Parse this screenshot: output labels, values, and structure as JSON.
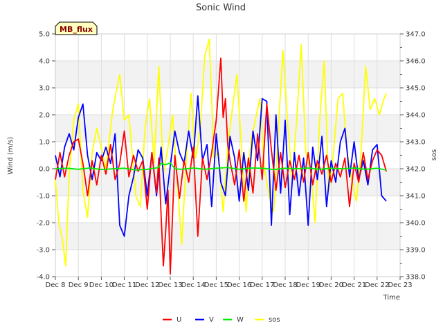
{
  "chart_data": {
    "type": "line",
    "title": "Sonic Wind",
    "badge": "MB_flux",
    "xlabel": "Time",
    "ylabel": "Wind (m/s)",
    "y2label": "sos",
    "x_ticks": [
      "Dec 8",
      "Dec 9",
      "Dec 10",
      "Dec 11",
      "Dec 12",
      "Dec 13",
      "Dec 14",
      "Dec 15",
      "Dec 16",
      "Dec 17",
      "Dec 18",
      "Dec 19",
      "Dec 20",
      "Dec 21",
      "Dec 22",
      "Dec 23"
    ],
    "xlim": [
      0,
      15
    ],
    "ylim": [
      -4.0,
      5.0
    ],
    "y_ticks": [
      "-4.0",
      "-3.0",
      "-2.0",
      "-1.0",
      "0.0",
      "1.0",
      "2.0",
      "3.0",
      "4.0",
      "5.0"
    ],
    "y2lim": [
      338.0,
      347.0
    ],
    "y2_ticks": [
      "338.0",
      "339.0",
      "340.0",
      "341.0",
      "342.0",
      "343.0",
      "344.0",
      "345.0",
      "346.0",
      "347.0"
    ],
    "grid": true,
    "legend_position": "bottom",
    "series": [
      {
        "name": "U",
        "color": "#ff0000",
        "axis": "left",
        "x": [
          0.0,
          0.2,
          0.4,
          0.6,
          0.8,
          1.0,
          1.2,
          1.4,
          1.6,
          1.8,
          2.0,
          2.2,
          2.4,
          2.6,
          2.8,
          3.0,
          3.2,
          3.4,
          3.6,
          3.8,
          4.0,
          4.2,
          4.4,
          4.5,
          4.6,
          4.7,
          4.8,
          4.9,
          5.0,
          5.2,
          5.4,
          5.6,
          5.8,
          6.0,
          6.2,
          6.4,
          6.6,
          6.8,
          7.0,
          7.2,
          7.3,
          7.4,
          7.5,
          7.6,
          7.8,
          8.0,
          8.2,
          8.4,
          8.6,
          8.8,
          9.0,
          9.2,
          9.4,
          9.6,
          9.8,
          10.0,
          10.2,
          10.4,
          10.6,
          10.8,
          11.0,
          11.2,
          11.4,
          11.6,
          11.8,
          12.0,
          12.2,
          12.4,
          12.6,
          12.8,
          13.0,
          13.2,
          13.4,
          13.6,
          13.8,
          14.0,
          14.2,
          14.4
        ],
        "y": [
          -0.4,
          0.6,
          -0.3,
          0.5,
          1.0,
          1.1,
          0.2,
          -1.0,
          0.3,
          -0.6,
          0.5,
          -0.2,
          0.9,
          -0.4,
          0.2,
          1.4,
          -0.3,
          0.5,
          -0.1,
          0.3,
          -1.5,
          0.6,
          -0.9,
          0.4,
          -1.7,
          -3.6,
          -2.3,
          -0.8,
          -3.9,
          0.5,
          -1.1,
          0.3,
          -0.5,
          0.8,
          -2.5,
          0.4,
          -0.4,
          0.6,
          1.8,
          4.1,
          1.9,
          2.6,
          0.9,
          0.3,
          -0.6,
          0.7,
          -1.2,
          0.4,
          -0.9,
          1.3,
          -0.4,
          2.4,
          0.7,
          -0.8,
          0.6,
          -0.7,
          0.3,
          -0.4,
          0.5,
          -0.5,
          0.6,
          -0.6,
          0.3,
          -0.2,
          0.5,
          -0.5,
          0.2,
          -0.3,
          0.4,
          -1.4,
          0.2,
          -0.5,
          0.6,
          -0.4,
          0.3,
          0.7,
          0.5,
          -0.1
        ]
      },
      {
        "name": "V",
        "color": "#0000ff",
        "axis": "left",
        "x": [
          0.0,
          0.2,
          0.4,
          0.6,
          0.8,
          1.0,
          1.2,
          1.4,
          1.6,
          1.8,
          2.0,
          2.2,
          2.4,
          2.6,
          2.8,
          3.0,
          3.2,
          3.4,
          3.6,
          3.8,
          4.0,
          4.2,
          4.4,
          4.6,
          4.8,
          5.0,
          5.2,
          5.4,
          5.6,
          5.8,
          6.0,
          6.2,
          6.4,
          6.6,
          6.8,
          7.0,
          7.2,
          7.4,
          7.6,
          7.8,
          8.0,
          8.2,
          8.4,
          8.6,
          8.8,
          9.0,
          9.2,
          9.4,
          9.6,
          9.8,
          10.0,
          10.2,
          10.4,
          10.6,
          10.8,
          11.0,
          11.2,
          11.4,
          11.6,
          11.8,
          12.0,
          12.2,
          12.4,
          12.6,
          12.8,
          13.0,
          13.2,
          13.4,
          13.6,
          13.8,
          14.0,
          14.2,
          14.4
        ],
        "y": [
          0.5,
          -0.3,
          0.8,
          1.3,
          0.7,
          1.9,
          2.4,
          0.5,
          -0.4,
          0.6,
          0.3,
          0.8,
          0.2,
          1.3,
          -2.1,
          -2.5,
          -1.0,
          -0.3,
          0.7,
          0.4,
          -1.0,
          0.6,
          -1.0,
          0.8,
          -1.3,
          0.1,
          1.4,
          0.6,
          0.2,
          1.4,
          0.4,
          2.7,
          0.3,
          0.9,
          -1.4,
          1.3,
          -0.5,
          -1.0,
          1.2,
          0.4,
          -1.2,
          0.6,
          -0.8,
          1.4,
          0.3,
          2.6,
          2.5,
          -2.1,
          2.0,
          -0.9,
          1.8,
          -1.7,
          0.6,
          -1.0,
          0.4,
          -2.1,
          0.8,
          -0.4,
          1.2,
          -1.4,
          0.3,
          -0.5,
          1.0,
          1.5,
          -0.3,
          1.0,
          -0.4,
          0.3,
          -0.6,
          0.7,
          0.9,
          -1.0,
          -1.2
        ]
      },
      {
        "name": "W",
        "color": "#00ee00",
        "axis": "left",
        "x": [
          0.0,
          0.5,
          1.0,
          1.5,
          2.0,
          2.5,
          3.0,
          3.5,
          4.0,
          4.5,
          4.6,
          4.8,
          5.0,
          5.2,
          5.5,
          6.0,
          6.5,
          7.0,
          7.5,
          8.0,
          8.5,
          9.0,
          9.5,
          10.0,
          10.5,
          11.0,
          11.5,
          12.0,
          12.5,
          13.0,
          13.5,
          14.0,
          14.4
        ],
        "y": [
          0.0,
          0.02,
          -0.02,
          0.03,
          -0.03,
          0.0,
          0.02,
          -0.05,
          -0.02,
          0.05,
          0.2,
          0.15,
          0.22,
          0.0,
          -0.02,
          0.03,
          -0.02,
          0.02,
          0.05,
          -0.02,
          0.03,
          0.02,
          -0.03,
          0.02,
          0.0,
          0.03,
          -0.02,
          0.02,
          0.0,
          0.03,
          -0.02,
          0.02,
          -0.05
        ]
      },
      {
        "name": "sos",
        "color": "#ffff00",
        "axis": "right",
        "x": [
          0.0,
          0.15,
          0.3,
          0.45,
          0.6,
          0.8,
          1.0,
          1.2,
          1.4,
          1.6,
          1.8,
          2.0,
          2.2,
          2.5,
          2.8,
          3.0,
          3.2,
          3.5,
          3.7,
          3.9,
          4.1,
          4.3,
          4.5,
          4.7,
          4.9,
          5.1,
          5.3,
          5.5,
          5.7,
          5.9,
          6.1,
          6.3,
          6.5,
          6.7,
          6.9,
          7.1,
          7.3,
          7.5,
          7.7,
          7.9,
          8.1,
          8.3,
          8.5,
          8.7,
          8.9,
          9.1,
          9.3,
          9.5,
          9.7,
          9.9,
          10.1,
          10.3,
          10.5,
          10.7,
          10.9,
          11.1,
          11.3,
          11.5,
          11.7,
          11.9,
          12.1,
          12.3,
          12.5,
          12.7,
          12.9,
          13.1,
          13.3,
          13.5,
          13.7,
          13.9,
          14.1,
          14.3,
          14.4
        ],
        "y": [
          341.6,
          340.0,
          339.4,
          338.4,
          341.8,
          343.8,
          344.4,
          341.2,
          340.2,
          342.6,
          343.5,
          342.8,
          342.0,
          344.2,
          345.5,
          343.8,
          344.0,
          341.0,
          340.6,
          343.5,
          344.6,
          342.2,
          345.8,
          341.8,
          342.8,
          344.0,
          341.6,
          339.2,
          342.4,
          344.8,
          342.4,
          343.4,
          346.2,
          346.8,
          342.4,
          342.6,
          340.4,
          342.8,
          344.2,
          345.5,
          342.8,
          340.4,
          343.0,
          343.8,
          344.6,
          342.0,
          341.0,
          340.4,
          343.4,
          346.4,
          343.8,
          341.6,
          343.8,
          346.6,
          342.6,
          342.0,
          340.0,
          343.8,
          346.0,
          341.2,
          342.6,
          344.6,
          344.8,
          342.6,
          341.6,
          340.8,
          342.6,
          345.8,
          344.2,
          344.6,
          344.0,
          344.6,
          344.8
        ]
      }
    ]
  }
}
